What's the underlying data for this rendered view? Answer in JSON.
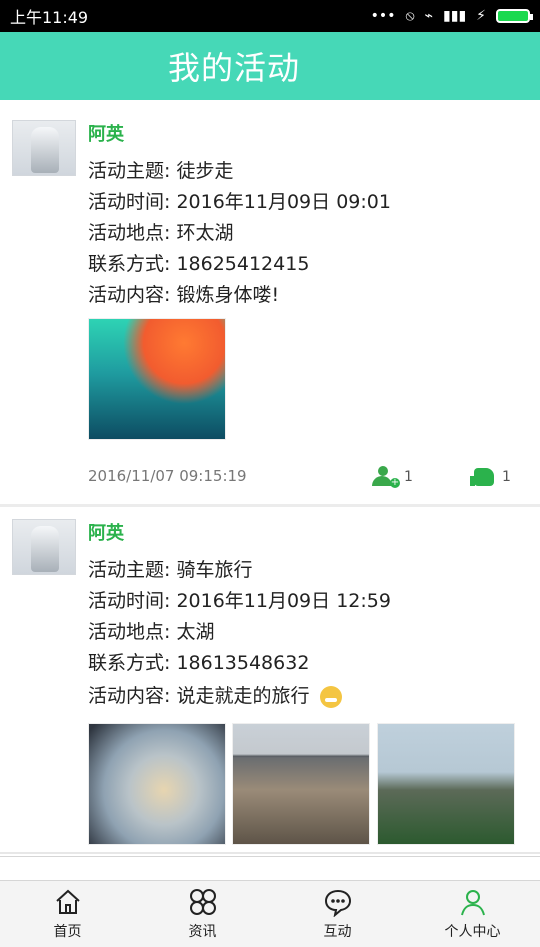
{
  "status": {
    "time": "上午11:49"
  },
  "header": {
    "title": "我的活动"
  },
  "posts": [
    {
      "user": "阿英",
      "fields": {
        "theme": "活动主题: 徒步走",
        "time": "活动时间: 2016年11月09日 09:01",
        "place": "活动地点: 环太湖",
        "contact": "联系方式: 18625412415",
        "content": "活动内容: 锻炼身体喽!"
      },
      "images": [
        "autumn-leaves-water"
      ],
      "timestamp": "2016/11/07 09:15:19",
      "join_count": "1",
      "like_count": "1"
    },
    {
      "user": "阿英",
      "fields": {
        "theme": "活动主题: 骑车旅行",
        "time": "活动时间: 2016年11月09日 12:59",
        "place": "活动地点: 太湖",
        "contact": "联系方式: 18613548632",
        "content": "活动内容: 说走就走的旅行"
      },
      "images": [
        "sky-lake",
        "river-bridge",
        "trees-lake"
      ]
    }
  ],
  "tabs": [
    {
      "label": "首页",
      "icon": "home-icon"
    },
    {
      "label": "资讯",
      "icon": "grid-icon"
    },
    {
      "label": "互动",
      "icon": "chat-icon"
    },
    {
      "label": "个人中心",
      "icon": "user-icon"
    }
  ],
  "colors": {
    "header_bg": "#46d8b7",
    "accent_green": "#2bb24c",
    "text": "#222222"
  }
}
